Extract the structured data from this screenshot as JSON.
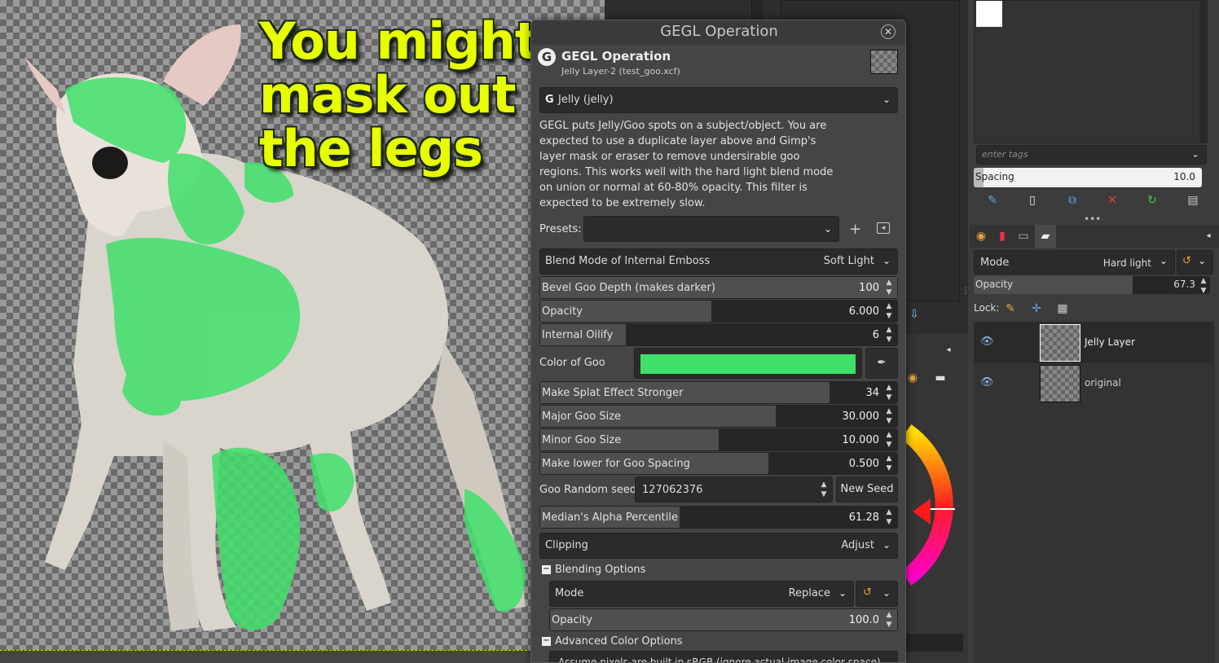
{
  "canvas": {
    "caption_lines": [
      "You might",
      "mask out",
      "the legs"
    ]
  },
  "dialog": {
    "window_title": "GEGL Operation",
    "header_title": "GEGL Operation",
    "header_subtitle": "Jelly Layer-2 (test_goo.xcf)",
    "operation_name": "Jelly (jelly)",
    "description": "GEGL puts Jelly/Goo spots on a subject/object. You are expected to use a duplicate layer above and Gimp's layer mask or eraser to remove undersirable goo regions. This works well with the hard light blend mode on union or normal at 60-80% opacity. This filter is expected to be extremely slow.",
    "presets_label": "Presets:",
    "blend_mode": {
      "label": "Blend Mode of Internal Emboss",
      "value": "Soft Light"
    },
    "bevel_depth": {
      "label": "Bevel Goo Depth (makes darker)",
      "value": "100",
      "fraction": 1.0
    },
    "opacity": {
      "label": "Opacity",
      "value": "6.000",
      "fraction": 0.48
    },
    "internal_oilify": {
      "label": "Internal Oilify",
      "value": "6",
      "fraction": 0.24
    },
    "color_of_goo": {
      "label": "Color of Goo",
      "color": "#3fe06a"
    },
    "splat_stronger": {
      "label": "Make Splat Effect Stronger",
      "value": "34",
      "fraction": 0.81
    },
    "major_goo_size": {
      "label": "Major Goo Size",
      "value": "30.000",
      "fraction": 0.66
    },
    "minor_goo_size": {
      "label": "Minor Goo Size",
      "value": "10.000",
      "fraction": 0.5
    },
    "goo_spacing": {
      "label": "Make lower for Goo Spacing",
      "value": "0.500",
      "fraction": 0.64
    },
    "random_seed": {
      "label": "Goo Random seed",
      "value": "127062376",
      "new_seed": "New Seed"
    },
    "median_alpha": {
      "label": "Median's Alpha Percentile",
      "value": "61.28",
      "fraction": 0.39
    },
    "clipping": {
      "label": "Clipping",
      "value": "Adjust"
    },
    "blending_options": {
      "label": "Blending Options",
      "mode_label": "Mode",
      "mode_value": "Replace",
      "opacity_label": "Opacity",
      "opacity_value": "100.0",
      "opacity_fraction": 1.0
    },
    "advanced_color": {
      "label": "Advanced Color Options",
      "option": "Assume pixels are built in sRGB (ignore actual image color space)"
    }
  },
  "dock": {
    "tags_placeholder": "enter tags",
    "spacing_label": "Spacing",
    "spacing_value": "10.0",
    "layers": {
      "mode_label": "Mode",
      "mode_value": "Hard light",
      "opacity_label": "Opacity",
      "opacity_value": "67.3",
      "opacity_fraction": 0.673,
      "lock_label": "Lock:",
      "items": [
        {
          "name": "Jelly Layer",
          "visible": true,
          "selected": true
        },
        {
          "name": "original",
          "visible": true,
          "selected": false
        }
      ]
    }
  }
}
